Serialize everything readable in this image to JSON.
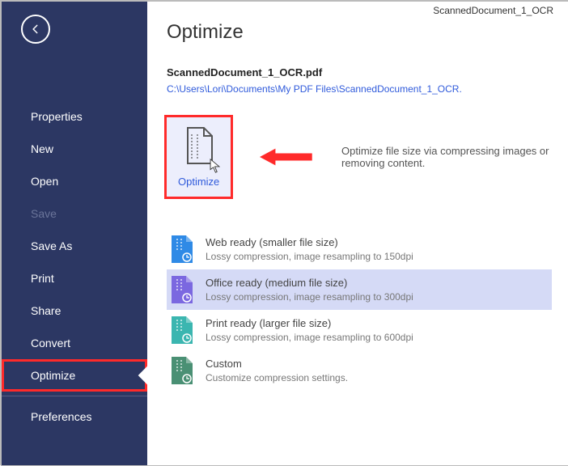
{
  "doc_label": "ScannedDocument_1_OCR",
  "page_title": "Optimize",
  "file_name": "ScannedDocument_1_OCR.pdf",
  "file_path": "C:\\Users\\Lori\\Documents\\My PDF Files\\ScannedDocument_1_OCR.",
  "action_tile": {
    "label": "Optimize"
  },
  "action_desc": "Optimize file size via compressing images or removing content.",
  "sidebar": {
    "items": [
      {
        "label": "Properties",
        "name": "sidebar-item-properties"
      },
      {
        "label": "New",
        "name": "sidebar-item-new"
      },
      {
        "label": "Open",
        "name": "sidebar-item-open"
      },
      {
        "label": "Save",
        "name": "sidebar-item-save",
        "disabled": true
      },
      {
        "label": "Save As",
        "name": "sidebar-item-save-as"
      },
      {
        "label": "Print",
        "name": "sidebar-item-print"
      },
      {
        "label": "Share",
        "name": "sidebar-item-share"
      },
      {
        "label": "Convert",
        "name": "sidebar-item-convert"
      },
      {
        "label": "Optimize",
        "name": "sidebar-item-optimize",
        "current": true
      },
      {
        "label": "Preferences",
        "name": "sidebar-item-preferences",
        "after_divider": true
      }
    ]
  },
  "presets": [
    {
      "title": "Web ready (smaller file size)",
      "desc": "Lossy compression, image resampling to 150dpi",
      "color": "#2f8ae6",
      "name": "preset-web"
    },
    {
      "title": "Office ready (medium file size)",
      "desc": "Lossy compression, image resampling to 300dpi",
      "color": "#7b68e0",
      "name": "preset-office",
      "selected": true
    },
    {
      "title": "Print ready (larger file size)",
      "desc": "Lossy compression, image resampling to 600dpi",
      "color": "#3bb6b0",
      "name": "preset-print"
    },
    {
      "title": "Custom",
      "desc": "Customize compression settings.",
      "color": "#4a9074",
      "name": "preset-custom"
    }
  ]
}
